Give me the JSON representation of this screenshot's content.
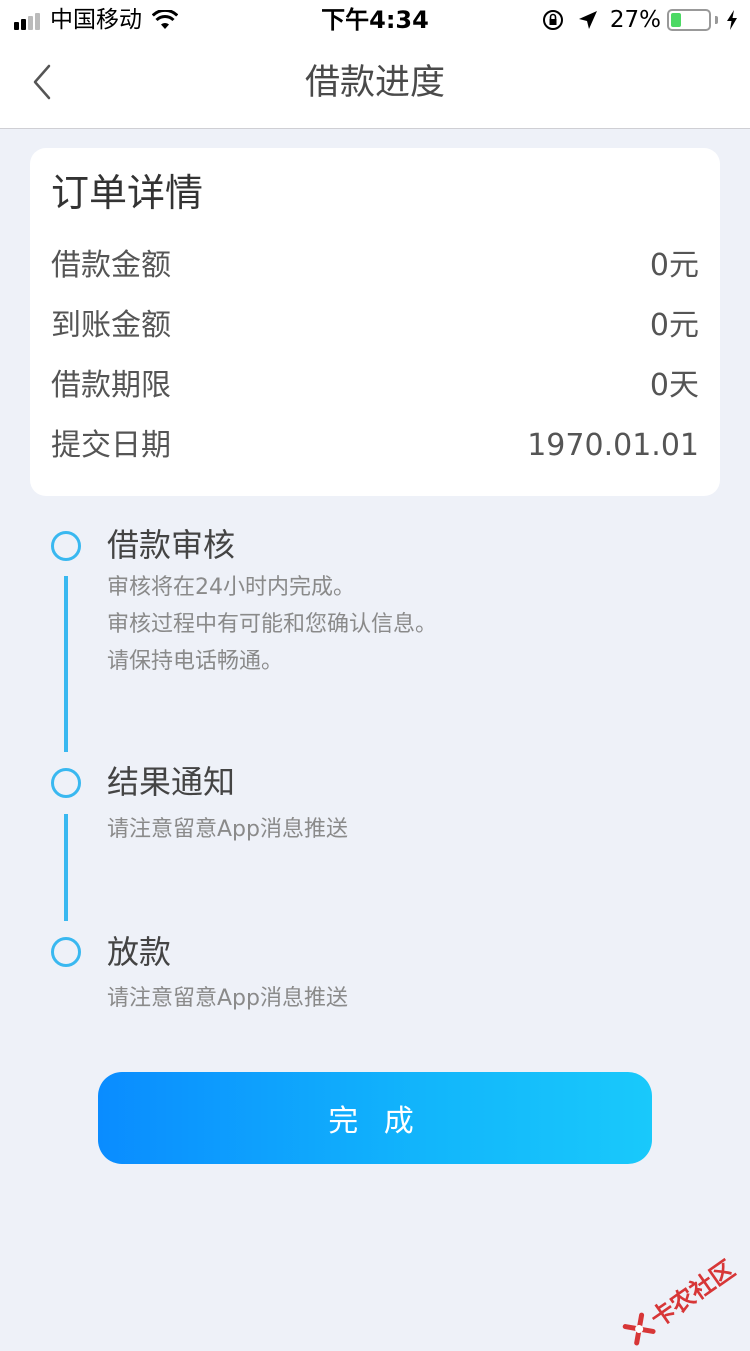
{
  "status_bar": {
    "carrier": "中国移动",
    "time": "下午4:34",
    "battery_percent": "27%",
    "battery_level": 0.27
  },
  "nav": {
    "title": "借款进度",
    "back_icon": "chevron-left-icon"
  },
  "order": {
    "title": "订单详情",
    "rows": [
      {
        "label": "借款金额",
        "value": "0元"
      },
      {
        "label": "到账金额",
        "value": "0元"
      },
      {
        "label": "借款期限",
        "value": "0天"
      },
      {
        "label": "提交日期",
        "value": "1970.01.01"
      }
    ]
  },
  "steps": [
    {
      "title": "借款审核",
      "desc": [
        "审核将在24小时内完成。",
        "审核过程中有可能和您确认信息。",
        "请保持电话畅通。"
      ]
    },
    {
      "title": "结果通知",
      "desc": [
        "请注意留意App消息推送"
      ]
    },
    {
      "title": "放款",
      "desc": [
        "请注意留意App消息推送"
      ]
    }
  ],
  "button": {
    "label": "完 成"
  },
  "watermark": {
    "text": "卡农社区"
  },
  "colors": {
    "accent": "#39b8f0",
    "button_start": "#0a8cff",
    "button_end": "#19c9fb",
    "background": "#eef1f8"
  }
}
